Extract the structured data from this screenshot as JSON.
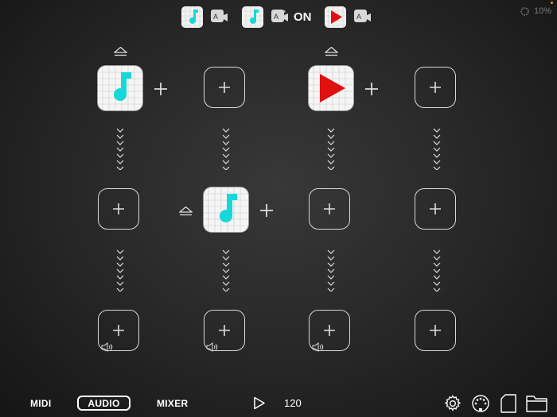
{
  "toolbar": {
    "icons": [
      {
        "name": "musical-note-plugin-icon",
        "color": "#16d8d8"
      },
      {
        "name": "musical-note-plugin-icon",
        "color": "#16d8d8"
      },
      {
        "name": "play-triangle-plugin-icon",
        "color": "#e01010"
      }
    ],
    "on_label": "ON",
    "cpu_label": "10%"
  },
  "grid": {
    "columns": 4,
    "rows": 3,
    "slots": [
      {
        "row": 0,
        "col": 0,
        "type": "plugin",
        "icon": "musical-note-plugin-icon",
        "eject": true
      },
      {
        "row": 0,
        "col": 1,
        "type": "empty"
      },
      {
        "row": 0,
        "col": 2,
        "type": "plugin",
        "icon": "play-triangle-plugin-icon",
        "eject": true
      },
      {
        "row": 0,
        "col": 3,
        "type": "empty"
      },
      {
        "row": 1,
        "col": 0,
        "type": "empty"
      },
      {
        "row": 1,
        "col": 1,
        "type": "plugin",
        "icon": "musical-note-plugin-icon",
        "eject": true
      },
      {
        "row": 1,
        "col": 2,
        "type": "empty"
      },
      {
        "row": 1,
        "col": 3,
        "type": "empty"
      },
      {
        "row": 2,
        "col": 0,
        "type": "empty",
        "speaker": true
      },
      {
        "row": 2,
        "col": 1,
        "type": "empty",
        "speaker": true
      },
      {
        "row": 2,
        "col": 2,
        "type": "empty",
        "speaker": true
      },
      {
        "row": 2,
        "col": 3,
        "type": "empty"
      }
    ]
  },
  "bottom": {
    "tabs": [
      {
        "label": "MIDI",
        "selected": false
      },
      {
        "label": "AUDIO",
        "selected": true
      },
      {
        "label": "MIXER",
        "selected": false
      }
    ],
    "tempo": "120"
  },
  "colors": {
    "accent_cyan": "#16d8d8",
    "accent_red": "#e01010",
    "background": "#262626",
    "foreground": "#ffffff"
  }
}
